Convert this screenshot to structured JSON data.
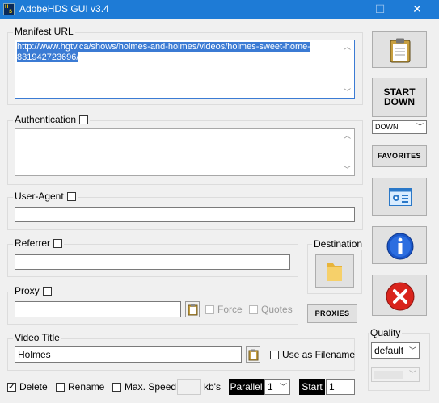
{
  "window": {
    "title": "AdobeHDS GUI v3.4",
    "minimize_glyph": "—",
    "maximize_glyph": "☐",
    "close_glyph": "✕"
  },
  "manifest": {
    "label": "Manifest URL",
    "value": "http://www.hgtv.ca/shows/holmes-and-holmes/videos/holmes-sweet-home-831942723696/"
  },
  "authentication": {
    "label": "Authentication",
    "checked": false,
    "value": ""
  },
  "user_agent": {
    "label": "User-Agent",
    "checked": false,
    "value": ""
  },
  "referrer": {
    "label": "Referrer",
    "checked": false,
    "value": ""
  },
  "destination": {
    "label": "Destination"
  },
  "proxy": {
    "label": "Proxy",
    "checked": false,
    "value": "",
    "force_label": "Force",
    "quotes_label": "Quotes"
  },
  "proxies_button": "PROXIES",
  "video_title": {
    "label": "Video Title",
    "value": "Holmes",
    "use_as_filename_label": "Use as Filename"
  },
  "bottom": {
    "delete_label": "Delete",
    "rename_label": "Rename",
    "max_speed_label": "Max. Speed",
    "speed_value": "",
    "speed_unit": "kb's",
    "parallel_label": "Parallel",
    "parallel_value": "1",
    "start_label": "Start",
    "start_value": "1"
  },
  "right_panel": {
    "start_down_line1": "START",
    "start_down_line2": "DOWN",
    "mode_select": "DOWN",
    "favorites": "FAVORITES",
    "quality_label": "Quality",
    "quality_value": "default",
    "quality_secondary_value": ""
  },
  "icons": {
    "app": "adobehds-app-icon",
    "clipboard": "clipboard-icon",
    "settings": "settings-panel-icon",
    "info": "info-icon",
    "exit": "exit-icon",
    "folder": "folder-icon"
  },
  "colors": {
    "titlebar": "#1e7bd6",
    "selection": "#3b7bd4",
    "info_blue": "#1a56c8",
    "exit_red": "#d9241c"
  }
}
